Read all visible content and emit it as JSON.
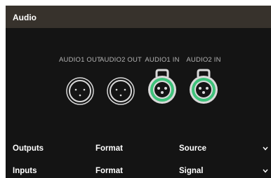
{
  "panel": {
    "title": "Audio"
  },
  "ports": [
    {
      "label": "AUDIO1 OUT",
      "type": "xlr-male",
      "connected": false
    },
    {
      "label": "AUDIO2 OUT",
      "type": "xlr-male",
      "connected": false
    },
    {
      "label": "AUDIO1 IN",
      "type": "xlr-female",
      "connected": true
    },
    {
      "label": "AUDIO2 IN",
      "type": "xlr-female",
      "connected": true
    }
  ],
  "sections": [
    {
      "label": "Outputs",
      "column2": "Format",
      "column3": "Source",
      "icon": "chevron-down-icon"
    },
    {
      "label": "Inputs",
      "column2": "Format",
      "column3": "Signal",
      "icon": "chevron-down-icon"
    }
  ],
  "colors": {
    "header_bg": "#37322c",
    "panel_bg": "#141414",
    "active_ring": "#3ec27a",
    "connector_grey": "#d9d9d9"
  }
}
